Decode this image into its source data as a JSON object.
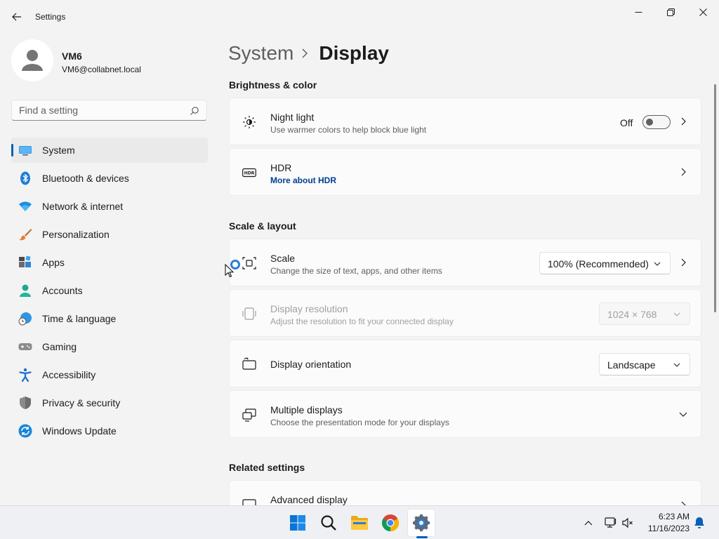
{
  "window": {
    "title": "Settings"
  },
  "user": {
    "name": "VM6",
    "email": "VM6@collabnet.local"
  },
  "search": {
    "placeholder": "Find a setting"
  },
  "nav": {
    "items": [
      {
        "label": "System",
        "icon": "monitor-icon",
        "selected": true
      },
      {
        "label": "Bluetooth & devices",
        "icon": "bluetooth-icon"
      },
      {
        "label": "Network & internet",
        "icon": "wifi-icon"
      },
      {
        "label": "Personalization",
        "icon": "brush-icon"
      },
      {
        "label": "Apps",
        "icon": "apps-icon"
      },
      {
        "label": "Accounts",
        "icon": "person-icon"
      },
      {
        "label": "Time & language",
        "icon": "clock-globe-icon"
      },
      {
        "label": "Gaming",
        "icon": "gamepad-icon"
      },
      {
        "label": "Accessibility",
        "icon": "accessibility-icon"
      },
      {
        "label": "Privacy & security",
        "icon": "shield-icon"
      },
      {
        "label": "Windows Update",
        "icon": "update-icon"
      }
    ]
  },
  "breadcrumb": {
    "parent": "System",
    "current": "Display"
  },
  "sections": {
    "brightness": "Brightness & color",
    "scale_layout": "Scale & layout",
    "related": "Related settings"
  },
  "night_light": {
    "title": "Night light",
    "subtitle": "Use warmer colors to help block blue light",
    "state": "Off"
  },
  "hdr": {
    "title": "HDR",
    "link": "More about HDR"
  },
  "scale": {
    "title": "Scale",
    "subtitle": "Change the size of text, apps, and other items",
    "value": "100% (Recommended)"
  },
  "resolution": {
    "title": "Display resolution",
    "subtitle": "Adjust the resolution to fit your connected display",
    "value": "1024 × 768"
  },
  "orientation": {
    "title": "Display orientation",
    "value": "Landscape"
  },
  "multiple": {
    "title": "Multiple displays",
    "subtitle": "Choose the presentation mode for your displays"
  },
  "advanced": {
    "title": "Advanced display"
  },
  "taskbar": {
    "apps": [
      "start-icon",
      "search-icon",
      "file-explorer-icon",
      "chrome-icon",
      "settings-icon"
    ],
    "time": "6:23 AM",
    "date": "11/16/2023"
  },
  "colors": {
    "accent": "#005fb8",
    "link": "#003e92"
  }
}
